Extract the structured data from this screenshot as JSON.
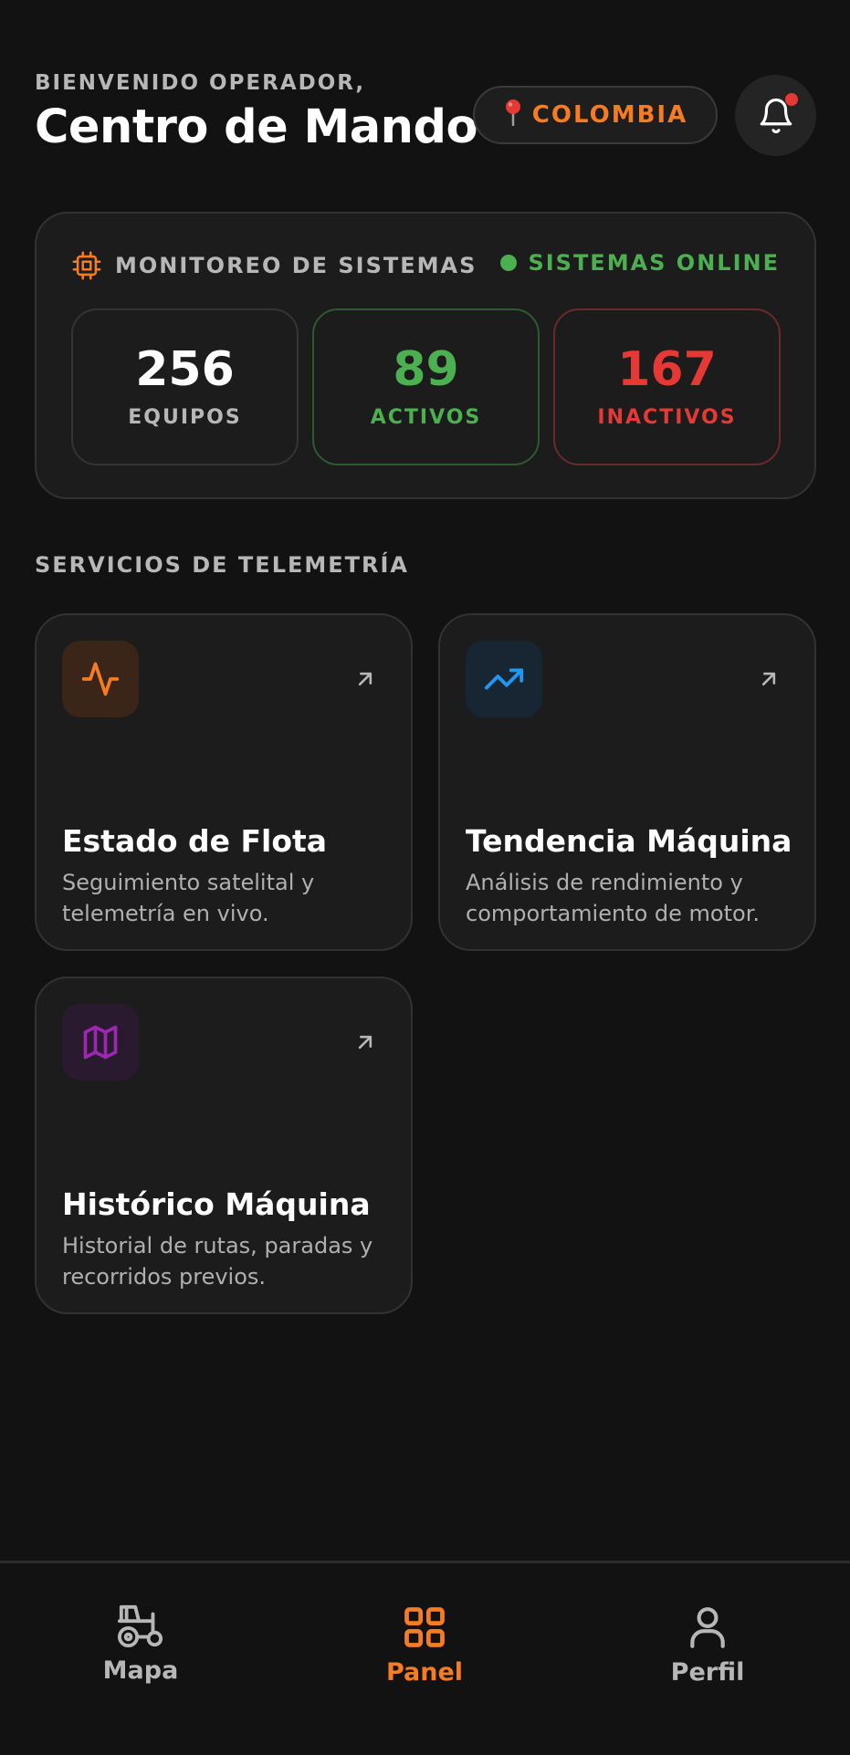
{
  "colors": {
    "accent": "#f57c23",
    "green": "#4caf50",
    "red": "#e53935",
    "blue": "#2196f3",
    "purple": "#9c27b0"
  },
  "header": {
    "welcome": "BIENVENIDO OPERADOR,",
    "title": "Centro de Mando",
    "location": "COLOMBIA",
    "location_icon": "pin-icon",
    "notification_icon": "bell-icon"
  },
  "systems": {
    "label": "MONITOREO DE SISTEMAS",
    "icon": "chip-icon",
    "status": "SISTEMAS ONLINE",
    "stats": [
      {
        "value": "256",
        "label": "EQUIPOS"
      },
      {
        "value": "89",
        "label": "ACTIVOS"
      },
      {
        "value": "167",
        "label": "INACTIVOS"
      }
    ]
  },
  "services": {
    "title": "SERVICIOS DE TELEMETRÍA",
    "items": [
      {
        "title": "Estado de Flota",
        "description": "Seguimiento satelital y telemetría en vivo.",
        "icon": "activity-icon"
      },
      {
        "title": "Tendencia Máquina",
        "description": "Análisis de rendimiento y comportamiento de motor.",
        "icon": "trending-up-icon"
      },
      {
        "title": "Histórico Máquina",
        "description": "Historial de rutas, paradas y recorridos previos.",
        "icon": "map-icon"
      }
    ]
  },
  "nav": {
    "items": [
      {
        "label": "Mapa",
        "icon": "tractor-icon"
      },
      {
        "label": "Panel",
        "icon": "grid-icon",
        "active": true
      },
      {
        "label": "Perfil",
        "icon": "user-icon"
      }
    ]
  }
}
